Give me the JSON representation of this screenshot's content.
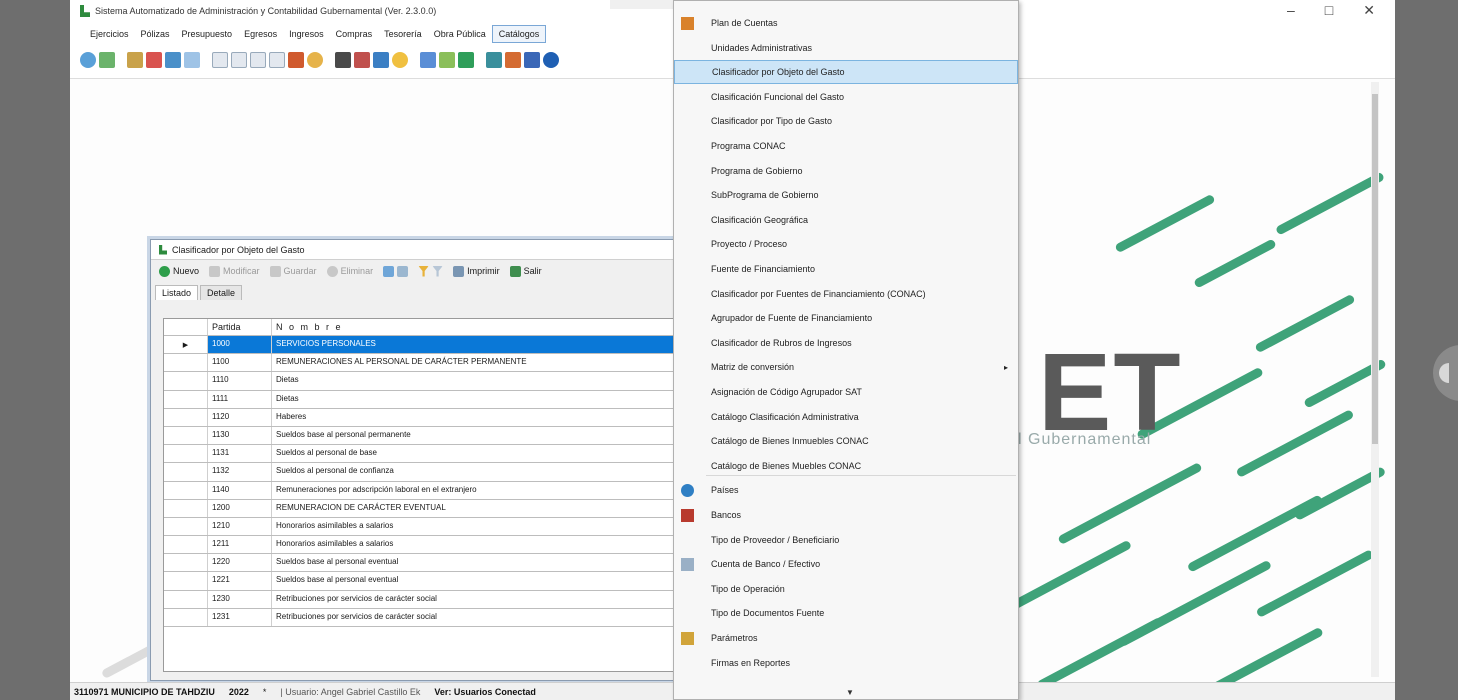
{
  "window": {
    "title": "Sistema Automatizado de Administración y Contabilidad Gubernamental (Ver. 2.3.0.0)",
    "minimize": "–",
    "maximize": "□",
    "close": "✕"
  },
  "menubar": [
    "Ejercicios",
    "Pólizas",
    "Presupuesto",
    "Egresos",
    "Ingresos",
    "Compras",
    "Tesorería",
    "Obra Pública",
    "Catálogos"
  ],
  "background_logo": {
    "text": "ET",
    "subtitle": "l Gubernamental"
  },
  "child_window": {
    "title": "Clasificador por Objeto del Gasto",
    "tools": {
      "nuevo": "Nuevo",
      "modificar": "Modificar",
      "guardar": "Guardar",
      "eliminar": "Eliminar",
      "imprimir": "Imprimir",
      "salir": "Salir"
    },
    "tabs": [
      "Listado",
      "Detalle"
    ],
    "grid": {
      "headers": {
        "code": "Partida",
        "name": "N o m b r e"
      },
      "rows": [
        {
          "code": "1000",
          "name": "SERVICIOS PERSONALES",
          "selected": true
        },
        {
          "code": "1100",
          "name": "REMUNERACIONES AL PERSONAL DE CARÁCTER PERMANENTE"
        },
        {
          "code": "1110",
          "name": "Dietas"
        },
        {
          "code": "1111",
          "name": "Dietas"
        },
        {
          "code": "1120",
          "name": "Haberes"
        },
        {
          "code": "1130",
          "name": "Sueldos base al personal permanente"
        },
        {
          "code": "1131",
          "name": "Sueldos al personal de base"
        },
        {
          "code": "1132",
          "name": "Sueldos al personal de confianza"
        },
        {
          "code": "1140",
          "name": "Remuneraciones por adscripción laboral en el extranjero"
        },
        {
          "code": "1200",
          "name": "REMUNERACION DE CARÁCTER EVENTUAL"
        },
        {
          "code": "1210",
          "name": "Honorarios asimilables a salarios"
        },
        {
          "code": "1211",
          "name": "Honorarios asimilables a salarios"
        },
        {
          "code": "1220",
          "name": "Sueldos base al personal eventual"
        },
        {
          "code": "1221",
          "name": "Sueldos base al personal eventual"
        },
        {
          "code": "1230",
          "name": "Retribuciones por servicios de carácter social"
        },
        {
          "code": "1231",
          "name": "Retribuciones por servicios de carácter social"
        }
      ]
    }
  },
  "dropdown": {
    "items": [
      "Plan de Cuentas",
      "Unidades Administrativas",
      "Clasificador por Objeto del Gasto",
      "Clasificación Funcional del Gasto",
      "Clasificador por Tipo de Gasto",
      "Programa CONAC",
      "Programa de Gobierno",
      "SubPrograma de Gobierno",
      "Clasificación Geográfica",
      "Proyecto / Proceso",
      "Fuente de Financiamiento",
      "Clasificador por Fuentes de Financiamiento (CONAC)",
      "Agrupador de Fuente de Financiamiento",
      "Clasificador de Rubros de Ingresos",
      "Matriz de conversión",
      "Asignación de Código Agrupador SAT",
      "Catálogo Clasificación Administrativa",
      "Catálogo de Bienes Inmuebles CONAC",
      "Catálogo de Bienes Muebles CONAC",
      "Países",
      "Bancos",
      "Tipo de Proveedor / Beneficiario",
      "Cuenta de Banco / Efectivo",
      "Tipo de Operación",
      "Tipo de Documentos Fuente",
      "Parámetros",
      "Firmas en Reportes"
    ],
    "highlighted": "Clasificador por Objeto del Gasto",
    "submenu_arrow": "▸",
    "scroll_arrow": "▼"
  },
  "statusbar": {
    "entity": "3110971 MUNICIPIO DE TAHDZIU",
    "year": "2022",
    "star": "*",
    "user": "| Usuario: Angel Gabriel Castillo Ek",
    "connected": "Ver: Usuarios Conectad"
  },
  "colors": {
    "selection": "#0a78d7",
    "menu_highlight": "#cde5f7",
    "stripe_green": "#3fa37a",
    "stripe_gray": "#d7d7d7"
  }
}
